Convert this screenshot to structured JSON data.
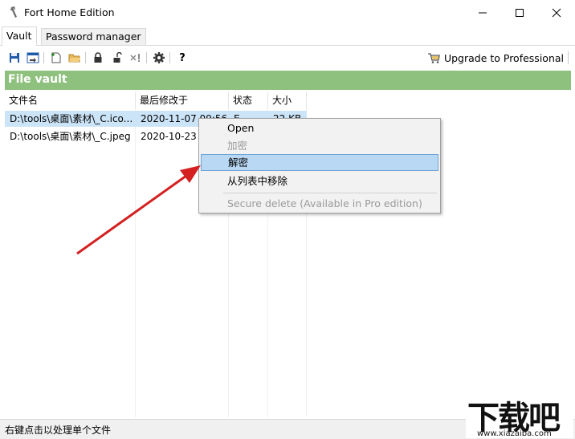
{
  "window": {
    "title": "Fort Home Edition"
  },
  "tabs": [
    {
      "label": "Vault"
    },
    {
      "label": "Password manager"
    }
  ],
  "toolbar": {
    "icons": [
      "save-icon",
      "import-icon",
      "new-file-icon",
      "open-folder-icon",
      "lock-icon",
      "unlock-icon",
      "remove-icon",
      "settings-icon",
      "help-icon"
    ],
    "help_label": "?",
    "upgrade_label": "Upgrade to Professional"
  },
  "vault": {
    "heading": "File vault"
  },
  "table": {
    "columns": [
      "文件名",
      "最后修改于",
      "状态",
      "大小"
    ],
    "rows": [
      {
        "name": "D:\\tools\\桌面\\素材\\_C.ico...",
        "modified": "2020-11-07 09:56",
        "status": "E",
        "size": "22 KB"
      },
      {
        "name": "D:\\tools\\桌面\\素材\\_C.jpeg",
        "modified": "2020-10-23 1",
        "status": "",
        "size": ""
      }
    ]
  },
  "context_menu": {
    "items": [
      {
        "label": "Open",
        "enabled": true
      },
      {
        "label": "加密",
        "enabled": false
      },
      {
        "label": "解密",
        "enabled": true,
        "highlighted": true
      },
      {
        "label": "从列表中移除",
        "enabled": true
      },
      {
        "label": "Secure delete (Available in Pro edition)",
        "enabled": false
      }
    ]
  },
  "statusbar": {
    "text": "右键点击以处理单个文件"
  },
  "watermark": {
    "text": "下载吧",
    "url": "www.xiazaiba.com"
  },
  "colors": {
    "vault_bar": "#8fc17e",
    "selection": "#cce4f7",
    "menu_highlight": "#b9d8f3",
    "arrow": "#d42020"
  }
}
